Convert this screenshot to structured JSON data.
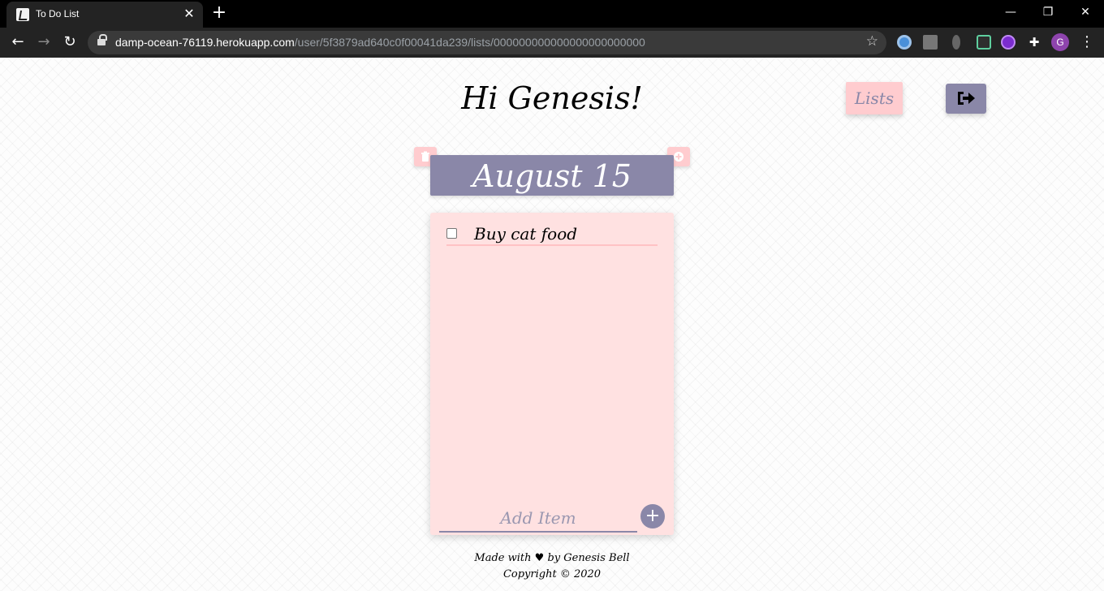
{
  "browser": {
    "tab_title": "To Do List",
    "url_host": "damp-ocean-76119.herokuapp.com",
    "url_path": "/user/5f3879ad640c0f00041da239/lists/000000000000000000000000",
    "profile_initial": "G"
  },
  "header": {
    "greeting": "Hi Genesis!",
    "lists_label": "Lists"
  },
  "list": {
    "title": "August 15",
    "items": [
      {
        "label": "Buy cat food",
        "checked": false
      }
    ],
    "add_placeholder": "Add Item",
    "add_button_label": "+"
  },
  "footer": {
    "made_with_prefix": "Made with",
    "heart": "♥",
    "made_with_suffix": "by Genesis Bell",
    "copyright": "Copyright © 2020"
  },
  "colors": {
    "accent_purple": "#8a87a8",
    "accent_pink": "#ffcccf",
    "card_bg": "#ffe1e1"
  }
}
